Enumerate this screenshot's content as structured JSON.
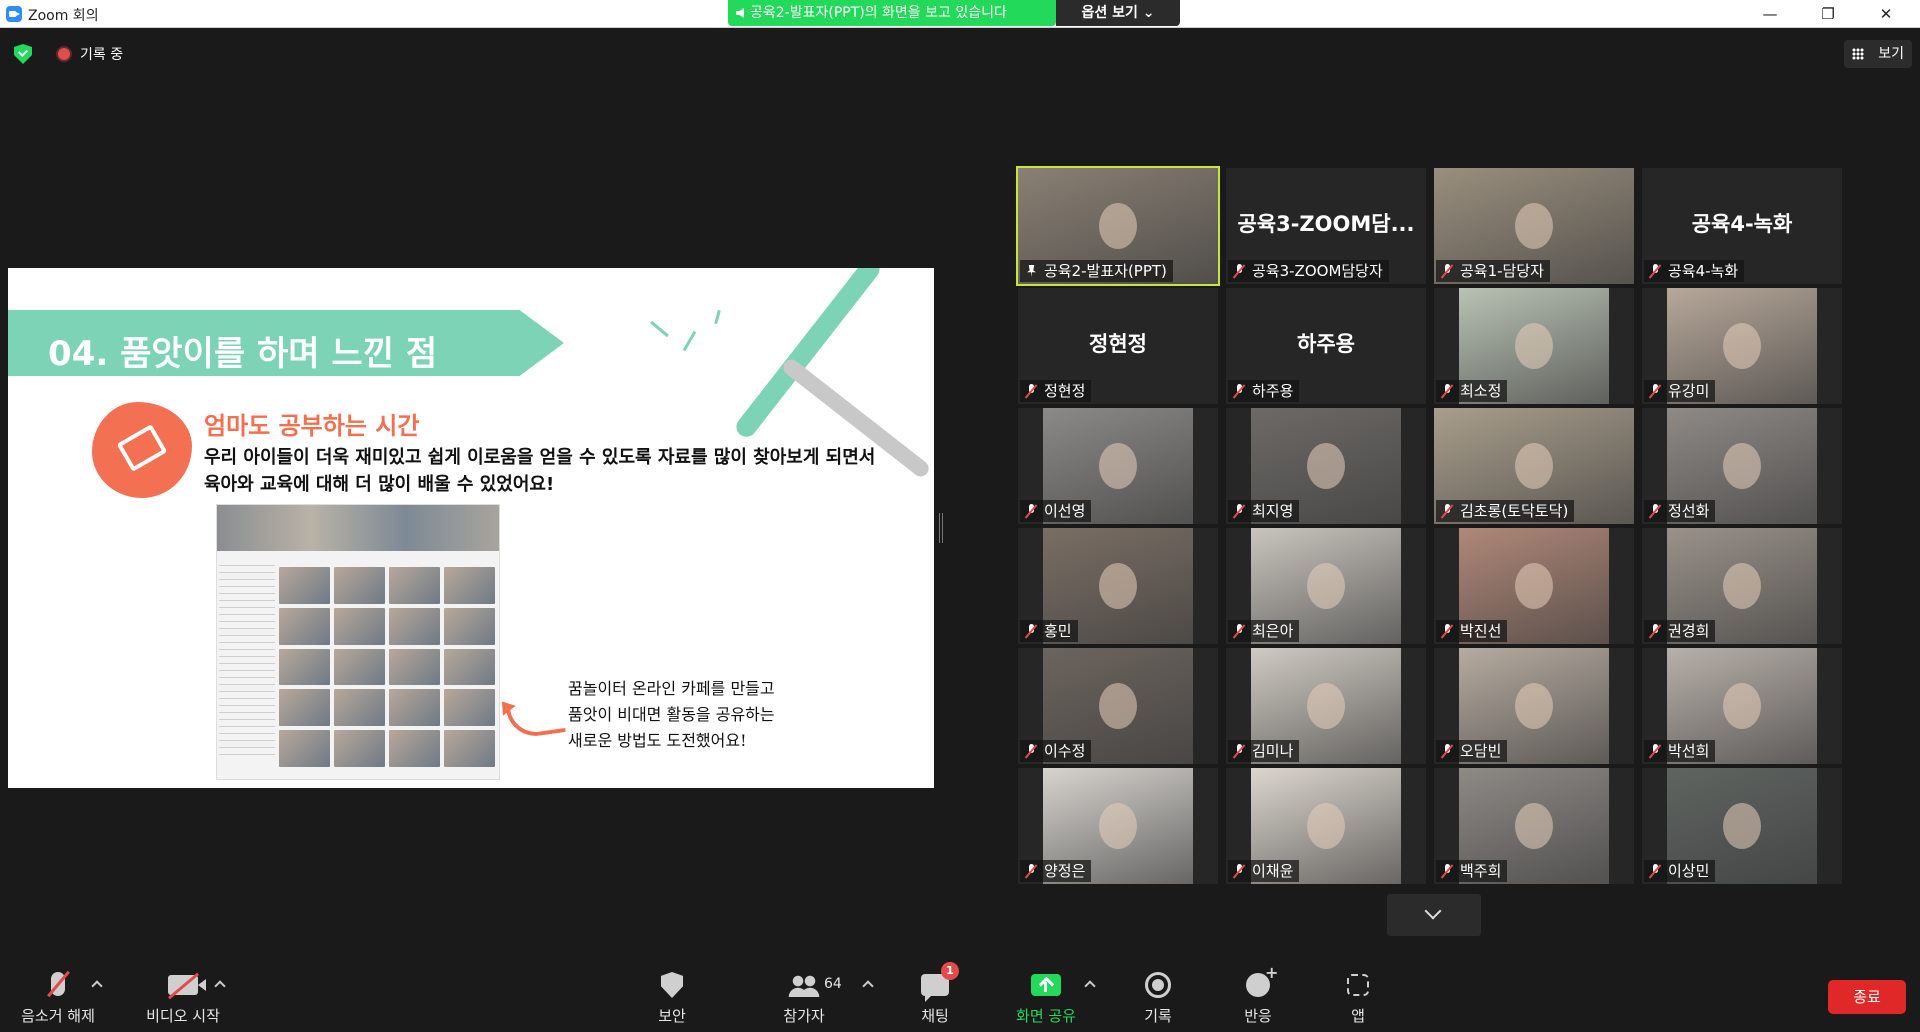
{
  "window": {
    "title": "Zoom 회의",
    "minimize": "—",
    "restore": "❐",
    "close": "✕"
  },
  "share_banner": {
    "text": "공육2-발표자(PPT)의 화면을 보고 있습니다",
    "view_options": "옵션 보기 ⌄"
  },
  "status": {
    "recording": "기록 중",
    "view_label": "보기"
  },
  "slide": {
    "heading": "04. 품앗이를 하며 느낀 점",
    "subtitle": "엄마도 공부하는 시간",
    "body_line1": "우리 아이들이 더욱 재미있고 쉽게 이로움을 얻을 수 있도록 자료를 많이 찾아보게 되면서",
    "body_line2": "육아와 교육에 대해 더 많이 배울 수 있었어요!",
    "note_line1": "꿈놀이터 온라인 카페를 만들고",
    "note_line2": "품앗이 비대면 활동을 공유하는",
    "note_line3": "새로운 방법도 도전했어요!"
  },
  "participants": [
    {
      "name": "공육2-발표자(PPT)",
      "video": true,
      "pinned": true,
      "active": true,
      "tone": "#8a8074"
    },
    {
      "name": "공육3-ZOOM담당자",
      "video": false,
      "display": "공육3-ZOOM담..."
    },
    {
      "name": "공육1-담당자",
      "video": true,
      "tone": "#9a8f7e"
    },
    {
      "name": "공육4-녹화",
      "video": false,
      "display": "공육4-녹화"
    },
    {
      "name": "정현정",
      "video": false,
      "display": "정현정"
    },
    {
      "name": "하주용",
      "video": false,
      "display": "하주용"
    },
    {
      "name": "최소정",
      "video": true,
      "tone": "#b9c2b4"
    },
    {
      "name": "유강미",
      "video": true,
      "tone": "#b7a89a"
    },
    {
      "name": "이선영",
      "video": true,
      "tone": "#8c8a88"
    },
    {
      "name": "최지영",
      "video": true,
      "tone": "#6d6a66"
    },
    {
      "name": "김초롱(토닥토닥)",
      "video": true,
      "tone": "#a99e8c"
    },
    {
      "name": "정선화",
      "video": true,
      "tone": "#8f8a86"
    },
    {
      "name": "홍민",
      "video": true,
      "tone": "#7a6e64"
    },
    {
      "name": "최은아",
      "video": true,
      "tone": "#c9c5be"
    },
    {
      "name": "박진선",
      "video": true,
      "tone": "#b08878"
    },
    {
      "name": "권경희",
      "video": true,
      "tone": "#9a928a"
    },
    {
      "name": "이수정",
      "video": true,
      "tone": "#6c645e"
    },
    {
      "name": "김미나",
      "video": true,
      "tone": "#cfcac2"
    },
    {
      "name": "오담빈",
      "video": true,
      "tone": "#b6aba0"
    },
    {
      "name": "박선희",
      "video": true,
      "tone": "#b8b0aa"
    },
    {
      "name": "양정은",
      "video": true,
      "tone": "#d7d4cf"
    },
    {
      "name": "이채윤",
      "video": true,
      "tone": "#dcd6ce"
    },
    {
      "name": "백주희",
      "video": true,
      "tone": "#8e8a86"
    },
    {
      "name": "이상민",
      "video": true,
      "tone": "#5f6461"
    }
  ],
  "toolbar": {
    "unmute": "음소거 해제",
    "start_video": "비디오 시작",
    "security": "보안",
    "participants": "참가자",
    "participant_count": "64",
    "chat": "채팅",
    "chat_badge": "1",
    "share_screen": "화면 공유",
    "record": "기록",
    "reactions": "반응",
    "apps": "앱",
    "end": "종료"
  },
  "colors": {
    "accent_green": "#23d959",
    "active_speaker": "#c7e63a",
    "end_red": "#e02828",
    "slide_mint": "#7dd3b5",
    "slide_coral": "#f26f4f"
  }
}
